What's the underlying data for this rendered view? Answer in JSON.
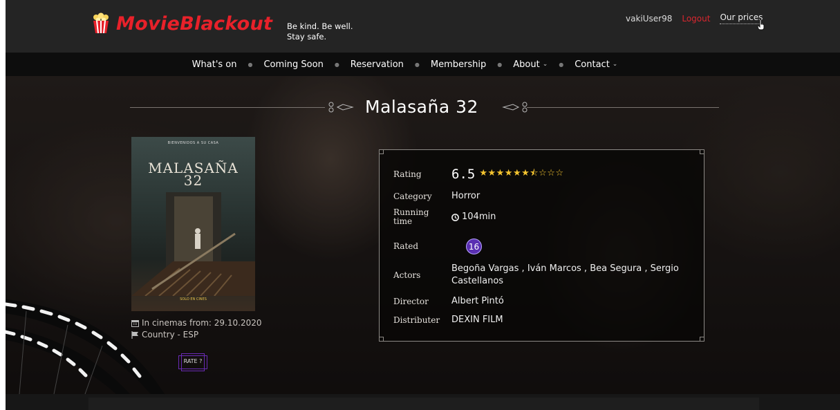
{
  "header": {
    "brand": "MovieBlackout",
    "tagline_line1": "Be kind. Be well.",
    "tagline_line2": "Stay safe.",
    "username": "vakiUser98",
    "logout": "Logout",
    "prices": "Our prices"
  },
  "nav": {
    "items": [
      {
        "label": "What's on"
      },
      {
        "label": "Coming Soon"
      },
      {
        "label": "Reservation"
      },
      {
        "label": "Membership"
      },
      {
        "label": "About"
      },
      {
        "label": "Contact"
      }
    ]
  },
  "movie": {
    "title": "Malasaña 32",
    "poster": {
      "top_text": "BIENVENIDOS A SU CASA",
      "title_line1": "MALASAÑA",
      "title_line2": "32",
      "bottom_text": "SOLO EN CINES"
    },
    "in_cinemas": "In cinemas from: 29.10.2020",
    "country": "Country - ESP",
    "rate_button": "RATE ?",
    "details": {
      "rating_label": "Rating",
      "rating_value": "6.5",
      "stars_filled": 6.5,
      "stars_total": 10,
      "category_label": "Category",
      "category_value": "Horror",
      "running_label": "Running time",
      "running_value": "104min",
      "rated_label": "Rated",
      "rated_value": "16",
      "actors_label": "Actors",
      "actors_value": "Begoña Vargas , Iván Marcos , Bea Segura , Sergio Castellanos",
      "director_label": "Director",
      "director_value": "Albert Pintó",
      "distributer_label": "Distributer",
      "distributer_value": "DEXIN FILM"
    }
  },
  "colors": {
    "brand_red": "#e8212a",
    "star_gold": "#f4c430",
    "badge_purple": "#5a2fb2"
  }
}
